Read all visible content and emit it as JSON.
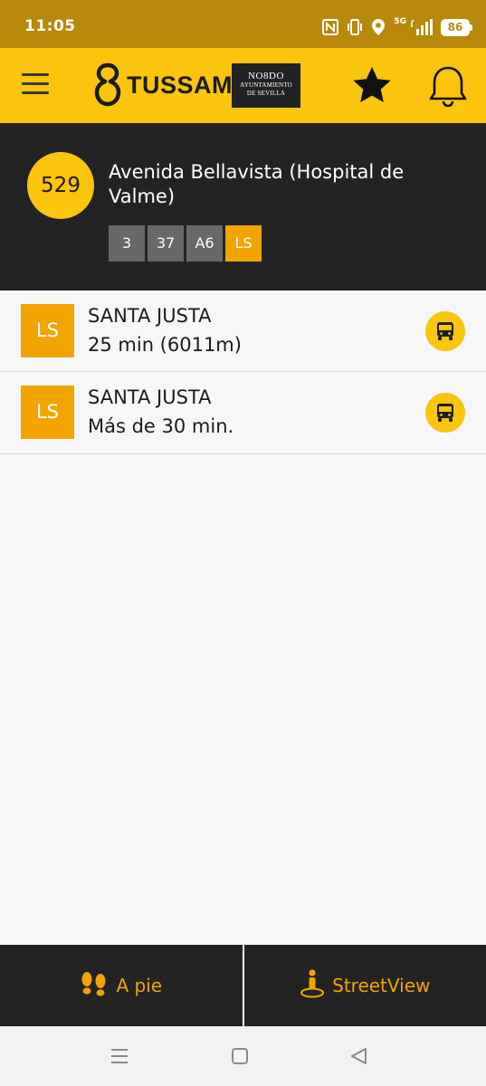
{
  "status_bar": {
    "time": "11:05",
    "network": "5G",
    "battery": "86",
    "icons": [
      "nfc-icon",
      "vibrate-icon",
      "location-icon",
      "signal-icon",
      "battery-icon"
    ]
  },
  "header": {
    "logo_text": "TUSSAM",
    "partner_logo": {
      "top": "NO8DO",
      "line1": "AYUNTAMIENTO",
      "line2": "DE SEVILLA"
    },
    "icons": [
      "menu-icon",
      "star-icon",
      "bell-icon"
    ]
  },
  "stop": {
    "number": "529",
    "name": "Avenida Bellavista (Hospital de Valme)",
    "routes": [
      "3",
      "37",
      "A6",
      "LS"
    ]
  },
  "arrivals": [
    {
      "line": "LS",
      "destination": "SANTA JUSTA",
      "time": "25 min (6011m)"
    },
    {
      "line": "LS",
      "destination": "SANTA JUSTA",
      "time": "Más de 30 min."
    }
  ],
  "bottom_bar": {
    "walk_label": "A pie",
    "streetview_label": "StreetView"
  },
  "colors": {
    "status_bar": "#b8890b",
    "header": "#fbc40d",
    "dark": "#232323",
    "accent": "#f2a400",
    "chip_grey": "#686868"
  }
}
